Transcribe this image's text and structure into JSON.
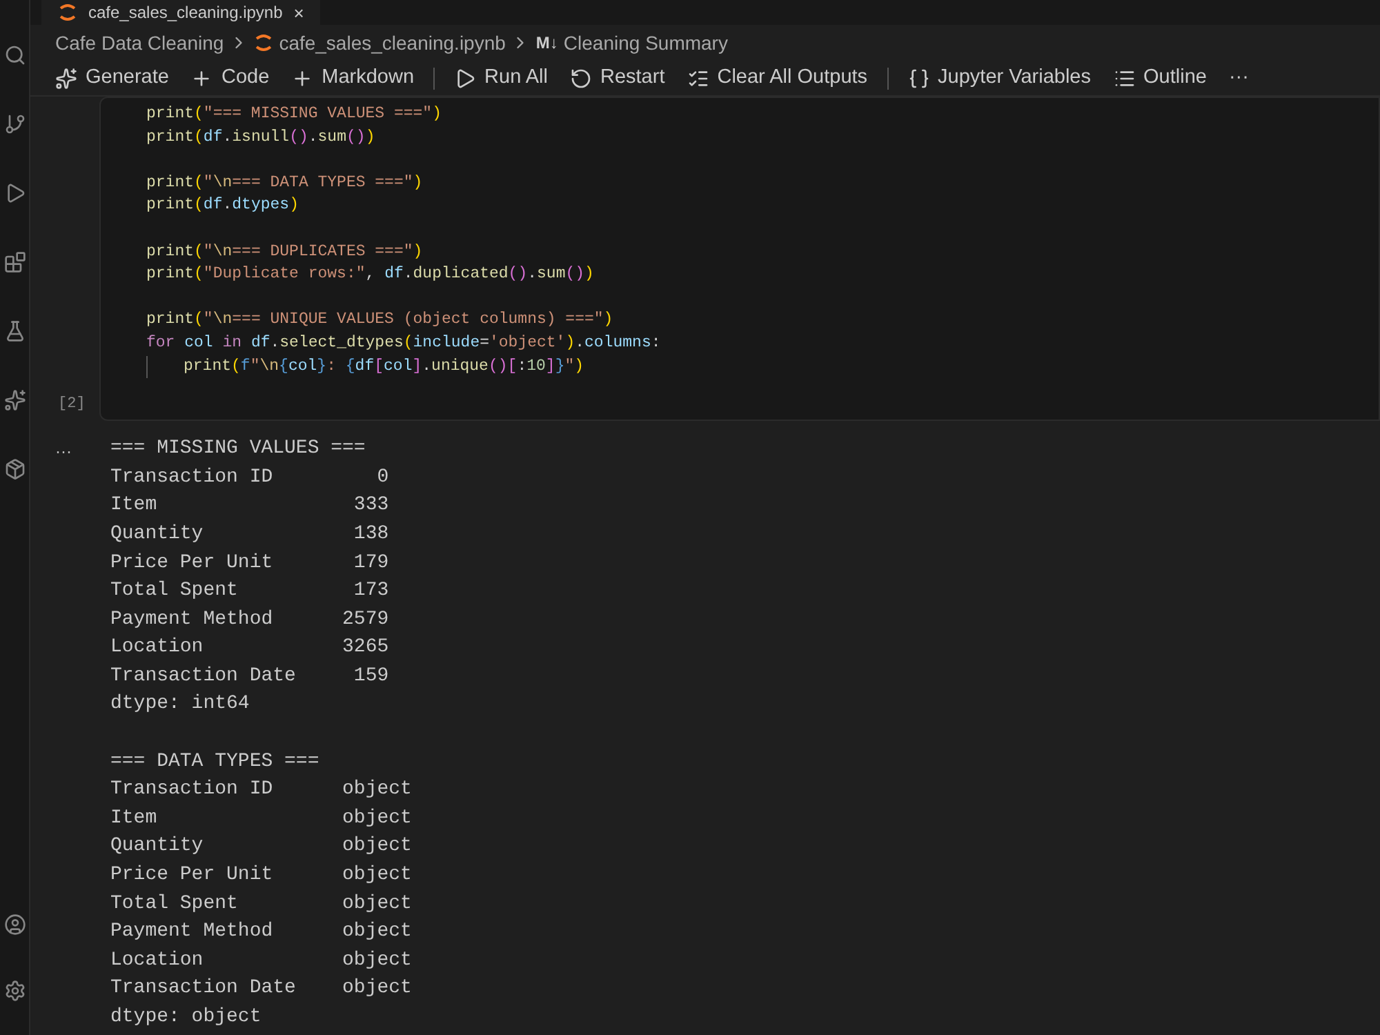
{
  "tab": {
    "title": "cafe_sales_cleaning.ipynb",
    "close": "×"
  },
  "breadcrumb": [
    {
      "text": "Cafe Data Cleaning",
      "kind": "folder"
    },
    {
      "text": "cafe_sales_cleaning.ipynb",
      "kind": "notebook"
    },
    {
      "text": "Cleaning Summary",
      "kind": "markdown",
      "icon": "M↓"
    }
  ],
  "toolbar": [
    {
      "label": "Generate",
      "kind": "sparkle",
      "divider_after": false
    },
    {
      "label": "Code",
      "kind": "plus",
      "divider_after": false
    },
    {
      "label": "Markdown",
      "kind": "plus",
      "divider_after": true
    },
    {
      "label": "Run All",
      "kind": "run",
      "divider_after": false
    },
    {
      "label": "Restart",
      "kind": "restart",
      "divider_after": false
    },
    {
      "label": "Clear All Outputs",
      "kind": "clear",
      "divider_after": true
    },
    {
      "label": "Jupyter Variables",
      "kind": "variables",
      "divider_after": false
    },
    {
      "label": "Outline",
      "kind": "outline",
      "divider_after": false
    },
    {
      "label": "···",
      "kind": "more",
      "divider_after": false
    }
  ],
  "cell": {
    "execution_count": "[2]",
    "blocks": [
      [
        {
          "indent": false,
          "tokens": [
            {
              "t": "print",
              "color": "#dcdcaa"
            },
            {
              "t": "(",
              "color": "#ffd700"
            },
            {
              "t": "\"=== MISSING VALUES ===\"",
              "color": "#ce9178"
            },
            {
              "t": ")",
              "color": "#ffd700"
            }
          ]
        },
        {
          "indent": false,
          "tokens": [
            {
              "t": "print",
              "color": "#dcdcaa"
            },
            {
              "t": "(",
              "color": "#ffd700"
            },
            {
              "t": "df",
              "color": "#9cdcfe"
            },
            {
              "t": ".",
              "color": "#d4d4d4"
            },
            {
              "t": "isnull",
              "color": "#dcdcaa"
            },
            {
              "t": "()",
              "color": "#da70d6"
            },
            {
              "t": ".",
              "color": "#d4d4d4"
            },
            {
              "t": "sum",
              "color": "#dcdcaa"
            },
            {
              "t": "()",
              "color": "#da70d6"
            },
            {
              "t": ")",
              "color": "#ffd700"
            }
          ]
        }
      ],
      [
        {
          "indent": false,
          "tokens": [
            {
              "t": "print",
              "color": "#dcdcaa"
            },
            {
              "t": "(",
              "color": "#ffd700"
            },
            {
              "t": "\"",
              "color": "#ce9178"
            },
            {
              "t": "\\n",
              "color": "#d7ba7d"
            },
            {
              "t": "=== DATA TYPES ===\"",
              "color": "#ce9178"
            },
            {
              "t": ")",
              "color": "#ffd700"
            }
          ]
        },
        {
          "indent": false,
          "tokens": [
            {
              "t": "print",
              "color": "#dcdcaa"
            },
            {
              "t": "(",
              "color": "#ffd700"
            },
            {
              "t": "df",
              "color": "#9cdcfe"
            },
            {
              "t": ".",
              "color": "#d4d4d4"
            },
            {
              "t": "dtypes",
              "color": "#9cdcfe"
            },
            {
              "t": ")",
              "color": "#ffd700"
            }
          ]
        }
      ],
      [
        {
          "indent": false,
          "tokens": [
            {
              "t": "print",
              "color": "#dcdcaa"
            },
            {
              "t": "(",
              "color": "#ffd700"
            },
            {
              "t": "\"",
              "color": "#ce9178"
            },
            {
              "t": "\\n",
              "color": "#d7ba7d"
            },
            {
              "t": "=== DUPLICATES ===\"",
              "color": "#ce9178"
            },
            {
              "t": ")",
              "color": "#ffd700"
            }
          ]
        },
        {
          "indent": false,
          "tokens": [
            {
              "t": "print",
              "color": "#dcdcaa"
            },
            {
              "t": "(",
              "color": "#ffd700"
            },
            {
              "t": "\"Duplicate rows:\"",
              "color": "#ce9178"
            },
            {
              "t": ", ",
              "color": "#d4d4d4"
            },
            {
              "t": "df",
              "color": "#9cdcfe"
            },
            {
              "t": ".",
              "color": "#d4d4d4"
            },
            {
              "t": "duplicated",
              "color": "#dcdcaa"
            },
            {
              "t": "()",
              "color": "#da70d6"
            },
            {
              "t": ".",
              "color": "#d4d4d4"
            },
            {
              "t": "sum",
              "color": "#dcdcaa"
            },
            {
              "t": "()",
              "color": "#da70d6"
            },
            {
              "t": ")",
              "color": "#ffd700"
            }
          ]
        }
      ],
      [
        {
          "indent": false,
          "tokens": [
            {
              "t": "print",
              "color": "#dcdcaa"
            },
            {
              "t": "(",
              "color": "#ffd700"
            },
            {
              "t": "\"",
              "color": "#ce9178"
            },
            {
              "t": "\\n",
              "color": "#d7ba7d"
            },
            {
              "t": "=== UNIQUE VALUES (object columns) ===\"",
              "color": "#ce9178"
            },
            {
              "t": ")",
              "color": "#ffd700"
            }
          ]
        },
        {
          "indent": false,
          "tokens": [
            {
              "t": "for ",
              "color": "#c586c0"
            },
            {
              "t": "col ",
              "color": "#9cdcfe"
            },
            {
              "t": "in ",
              "color": "#c586c0"
            },
            {
              "t": "df",
              "color": "#9cdcfe"
            },
            {
              "t": ".",
              "color": "#d4d4d4"
            },
            {
              "t": "select_dtypes",
              "color": "#dcdcaa"
            },
            {
              "t": "(",
              "color": "#ffd700"
            },
            {
              "t": "include",
              "color": "#9cdcfe"
            },
            {
              "t": "=",
              "color": "#d4d4d4"
            },
            {
              "t": "'object'",
              "color": "#ce9178"
            },
            {
              "t": ")",
              "color": "#ffd700"
            },
            {
              "t": ".",
              "color": "#d4d4d4"
            },
            {
              "t": "columns",
              "color": "#9cdcfe"
            },
            {
              "t": ":",
              "color": "#d4d4d4"
            }
          ]
        },
        {
          "indent": true,
          "tokens": [
            {
              "t": "print",
              "color": "#dcdcaa"
            },
            {
              "t": "(",
              "color": "#ffd700"
            },
            {
              "t": "f",
              "color": "#569cd6"
            },
            {
              "t": "\"",
              "color": "#ce9178"
            },
            {
              "t": "\\n",
              "color": "#d7ba7d"
            },
            {
              "t": "{",
              "color": "#569cd6"
            },
            {
              "t": "col",
              "color": "#9cdcfe"
            },
            {
              "t": "}",
              "color": "#569cd6"
            },
            {
              "t": ": ",
              "color": "#ce9178"
            },
            {
              "t": "{",
              "color": "#569cd6"
            },
            {
              "t": "df",
              "color": "#9cdcfe"
            },
            {
              "t": "[",
              "color": "#da70d6"
            },
            {
              "t": "col",
              "color": "#9cdcfe"
            },
            {
              "t": "]",
              "color": "#da70d6"
            },
            {
              "t": ".",
              "color": "#d4d4d4"
            },
            {
              "t": "unique",
              "color": "#dcdcaa"
            },
            {
              "t": "()",
              "color": "#da70d6"
            },
            {
              "t": "[",
              "color": "#da70d6"
            },
            {
              "t": ":",
              "color": "#d4d4d4"
            },
            {
              "t": "10",
              "color": "#b5cea8"
            },
            {
              "t": "]",
              "color": "#da70d6"
            },
            {
              "t": "}",
              "color": "#569cd6"
            },
            {
              "t": "\"",
              "color": "#ce9178"
            },
            {
              "t": ")",
              "color": "#ffd700"
            }
          ]
        }
      ]
    ]
  },
  "output": {
    "gutter": "···",
    "blocks": [
      [
        "=== MISSING VALUES ===",
        "Transaction ID         0",
        "Item                 333",
        "Quantity             138",
        "Price Per Unit       179",
        "Total Spent          173",
        "Payment Method      2579",
        "Location            3265",
        "Transaction Date     159",
        "dtype: int64"
      ],
      [
        "=== DATA TYPES ===",
        "Transaction ID      object",
        "Item                object",
        "Quantity            object",
        "Price Per Unit      object",
        "Total Spent         object",
        "Payment Method      object",
        "Location            object",
        "Transaction Date    object",
        "dtype: object"
      ]
    ]
  }
}
